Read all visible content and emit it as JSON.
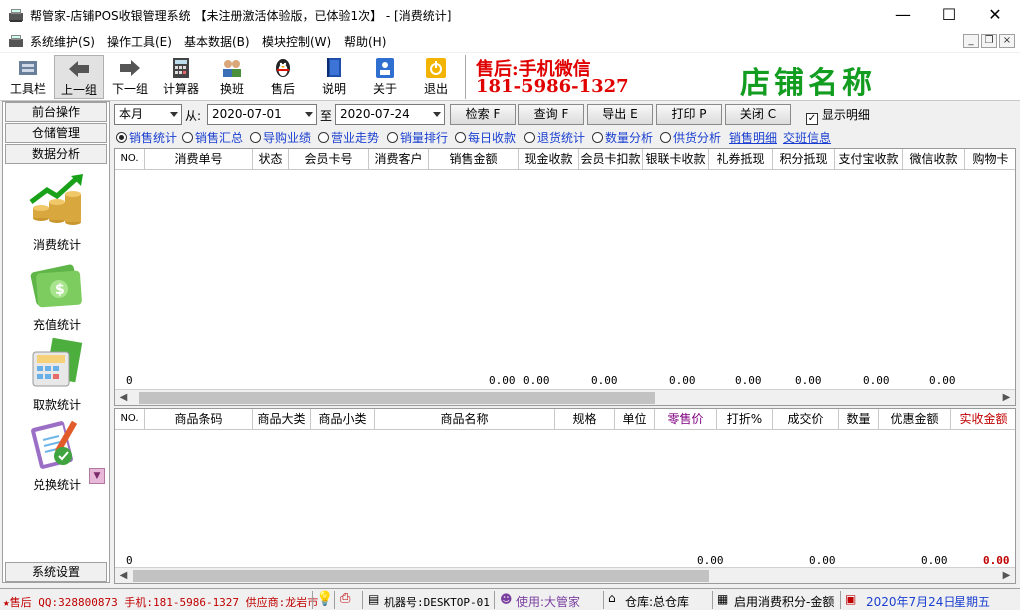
{
  "window": {
    "title": "帮管家-店铺POS收银管理系统 【未注册激活体验版，已体验1次】 - [消费统计]",
    "minimize": "—",
    "maximize": "☐",
    "close": "✕"
  },
  "menu": [
    "系统维护(S)",
    "操作工具(E)",
    "基本数据(B)",
    "模块控制(W)",
    "帮助(H)"
  ],
  "toolbar": [
    "工具栏",
    "上一组",
    "下一组",
    "计算器",
    "换班",
    "售后",
    "说明",
    "关于",
    "退出"
  ],
  "banner": {
    "aftersale": "售后:手机微信",
    "phone": "181-5986-1327",
    "store_name": "店铺名称"
  },
  "sidebar": {
    "tabs": [
      "前台操作",
      "仓储管理",
      "数据分析"
    ],
    "items": [
      "消费统计",
      "充值统计",
      "取款统计",
      "兑换统计"
    ],
    "bottom_tab": "系统设置"
  },
  "filter": {
    "period": "本月",
    "from_label": "从:",
    "from_date": "2020-07-01",
    "to_label": "至",
    "to_date": "2020-07-24",
    "buttons": [
      "检索 F",
      "查询 F",
      "导出 E",
      "打印 P",
      "关闭 C"
    ],
    "show_detail": "显示明细",
    "show_detail_checked": true
  },
  "radios": {
    "options": [
      "销售统计",
      "销售汇总",
      "导购业绩",
      "营业走势",
      "销量排行",
      "每日收款",
      "退货统计",
      "数量分析",
      "供货分析"
    ],
    "selected": "销售统计",
    "links": [
      "销售明细",
      "交班信息"
    ]
  },
  "top_table": {
    "columns": [
      "NO.",
      "消费单号",
      "状态",
      "会员卡号",
      "消费客户",
      "销售金额",
      "现金收款",
      "会员卡扣款",
      "银联卡收款",
      "礼券抵现",
      "积分抵现",
      "支付宝收款",
      "微信收款",
      "购物卡"
    ],
    "row_count": "0",
    "totals": [
      "0.00",
      "0.00",
      "0.00",
      "0.00",
      "0.00",
      "0.00",
      "0.00",
      "0.00"
    ]
  },
  "bottom_table": {
    "columns": [
      "NO.",
      "商品条码",
      "商品大类",
      "商品小类",
      "商品名称",
      "规格",
      "单位",
      "零售价",
      "打折%",
      "成交价",
      "数量",
      "优惠金额",
      "实收金额"
    ],
    "row_count": "0",
    "totals": [
      "0.00",
      "0.00",
      "0.00",
      "0.00"
    ]
  },
  "status": {
    "aftersale": "★售后 QQ:328800873 手机:181-5986-1327 供应商:龙岩市",
    "machine": "机器号:DESKTOP-01",
    "user": "使用:大管家",
    "warehouse": "仓库:总仓库",
    "points": "启用消费积分-金额",
    "date": "2020年7月24日",
    "weekday": "星期五"
  },
  "colors": {
    "accent_red": "#e00000",
    "store_green": "#139d20",
    "link_blue": "#1a3fd0",
    "retail_price": "#800080",
    "actual_amount": "#c00000"
  }
}
